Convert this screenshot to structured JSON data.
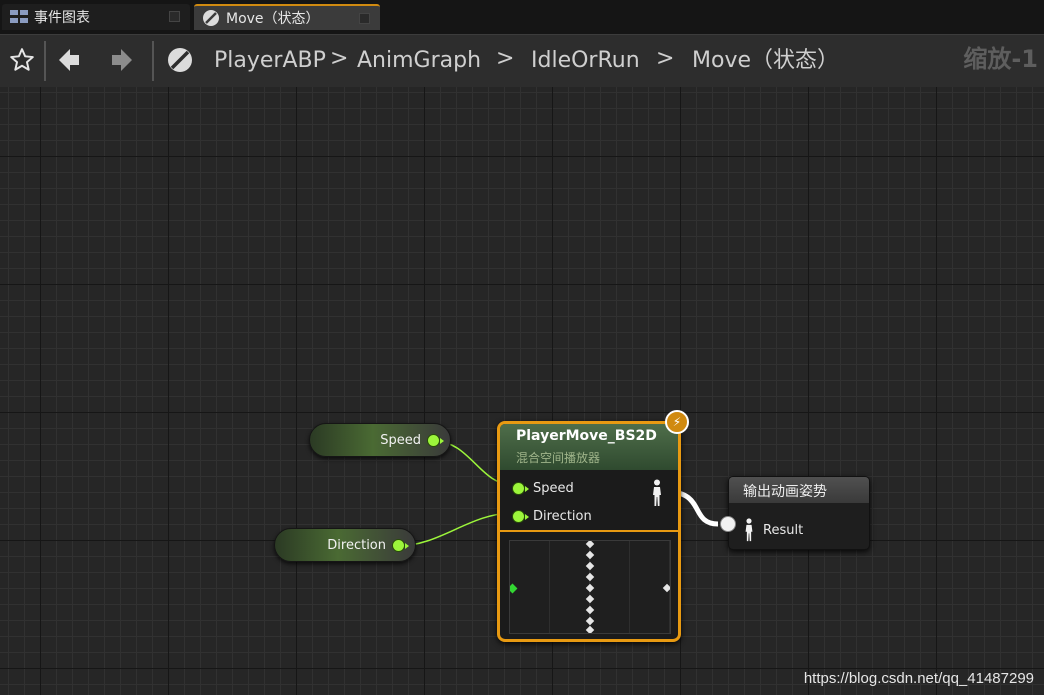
{
  "tabs": [
    {
      "label": "事件图表",
      "icon": "event-graph-icon",
      "active": false
    },
    {
      "label": "Move（状态）",
      "icon": "state-icon",
      "active": true
    }
  ],
  "breadcrumb": [
    "PlayerABP",
    "AnimGraph",
    "IdleOrRun",
    "Move（状态）"
  ],
  "breadcrumb_separator": ">",
  "zoom_label": "缩放-1",
  "variables": [
    {
      "label": "Speed"
    },
    {
      "label": "Direction"
    }
  ],
  "blendspace_node": {
    "title": "PlayerMove_BS2D",
    "subtitle": "混合空间播放器",
    "inputs": [
      "Speed",
      "Direction"
    ]
  },
  "output_node": {
    "title": "输出动画姿势",
    "pin_label": "Result"
  },
  "colors": {
    "accent_orange": "#e89a12",
    "float_pin": "#9cf53b",
    "pose_wire": "#ffffff"
  },
  "watermark": "https://blog.csdn.net/qq_41487299"
}
